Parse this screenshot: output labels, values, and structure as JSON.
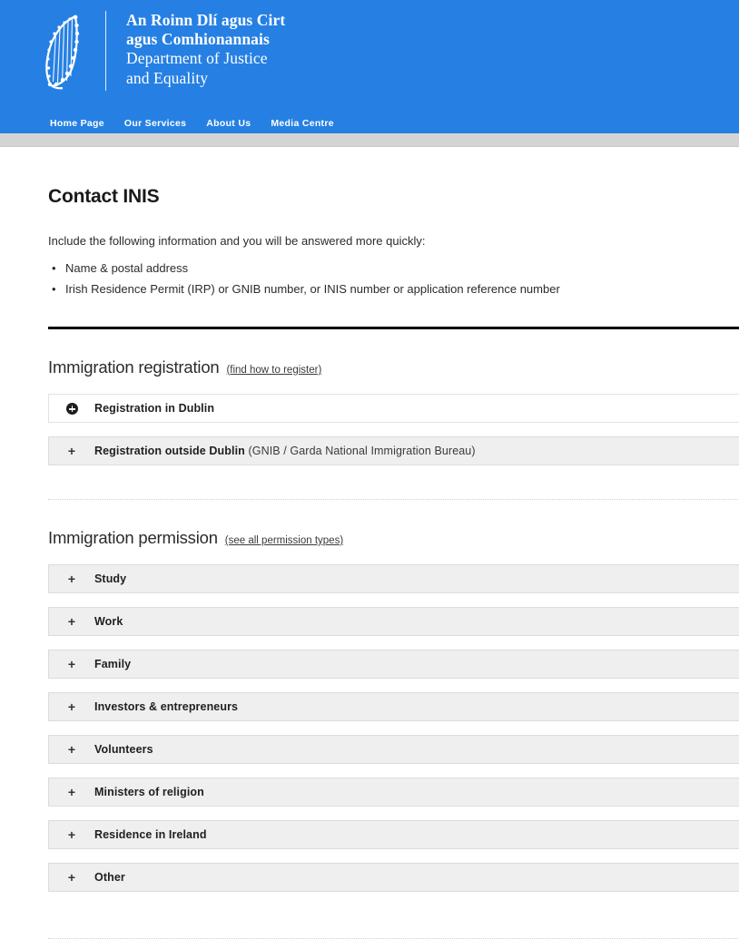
{
  "header": {
    "emblem_icon": "irish-harp-emblem",
    "brand_irish_line1": "An Roinn Dlí agus Cirt",
    "brand_irish_line2": "agus Comhionannais",
    "brand_english_line1": "Department of Justice",
    "brand_english_line2": "and Equality",
    "brand_color": "#2680E3",
    "nav": [
      {
        "label": "Home Page"
      },
      {
        "label": "Our Services"
      },
      {
        "label": "About Us"
      },
      {
        "label": "Media Centre"
      }
    ]
  },
  "page": {
    "title": "Contact INIS",
    "intro": "Include the following information and you will be answered more quickly:",
    "intro_list": [
      "Name & postal address",
      "Irish Residence Permit (IRP) or GNIB number, or INIS number or application reference number"
    ]
  },
  "sections": [
    {
      "heading": "Immigration registration",
      "link": "(find how to register)",
      "items": [
        {
          "icon": "circle-plus-icon",
          "label": "Registration in Dublin",
          "note": "",
          "state": "hover"
        },
        {
          "icon": "plus-icon",
          "label": "Registration outside Dublin",
          "note": "(GNIB / Garda National Immigration Bureau)",
          "state": "collapsed"
        }
      ]
    },
    {
      "heading": "Immigration permission",
      "link": "(see all permission types)",
      "items": [
        {
          "icon": "plus-icon",
          "label": "Study",
          "note": "",
          "state": "collapsed"
        },
        {
          "icon": "plus-icon",
          "label": "Work",
          "note": "",
          "state": "collapsed"
        },
        {
          "icon": "plus-icon",
          "label": "Family",
          "note": "",
          "state": "collapsed"
        },
        {
          "icon": "plus-icon",
          "label": "Investors & entrepreneurs",
          "note": "",
          "state": "collapsed"
        },
        {
          "icon": "plus-icon",
          "label": "Volunteers",
          "note": "",
          "state": "collapsed"
        },
        {
          "icon": "plus-icon",
          "label": "Ministers of religion",
          "note": "",
          "state": "collapsed"
        },
        {
          "icon": "plus-icon",
          "label": "Residence in Ireland",
          "note": "",
          "state": "collapsed"
        },
        {
          "icon": "plus-icon",
          "label": "Other",
          "note": "",
          "state": "collapsed"
        }
      ]
    }
  ],
  "symbols": {
    "plus": "+"
  }
}
